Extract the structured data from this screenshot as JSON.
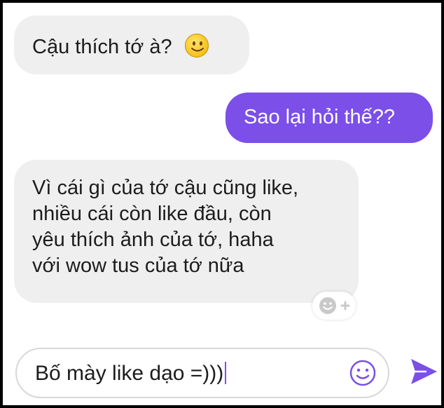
{
  "messages": [
    {
      "direction": "incoming",
      "text": "Cậu thích tớ à?",
      "emoji": "smiling-face-icon"
    },
    {
      "direction": "outgoing",
      "text": "Sao lại hỏi thế??"
    },
    {
      "direction": "incoming",
      "lines": [
        "Vì cái gì của tớ cậu cũng like,",
        "nhiều cái còn like đầu, còn",
        "yêu thích ảnh của tớ, haha",
        "với wow tus của tớ nữa"
      ]
    }
  ],
  "reaction_button": {
    "icon": "add-reaction-icon",
    "symbol": "+"
  },
  "composer": {
    "value": "Bố mày like dạo =)))",
    "emoji_icon": "emoji-icon",
    "send_icon": "send-icon"
  },
  "colors": {
    "accent": "#7b4fe8",
    "incoming_bubble": "#efefef",
    "frame": "#000000"
  }
}
